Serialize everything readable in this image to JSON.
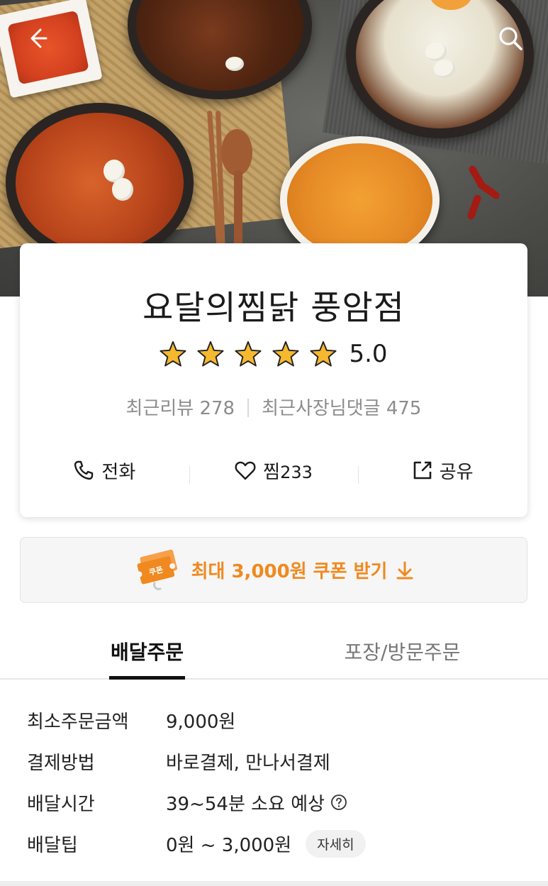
{
  "store": {
    "name": "요달의찜닭 풍암점",
    "rating": "5.0",
    "stars": 5,
    "reviews_label": "최근리뷰 278",
    "owner_replies_label": "최근사장님댓글 475"
  },
  "actions": {
    "call_label": "전화",
    "like_label": "찜",
    "like_count": "233",
    "share_label": "공유"
  },
  "coupon": {
    "ticket_label": "쿠폰",
    "text": "최대 3,000원 쿠폰 받기"
  },
  "tabs": {
    "delivery": "배달주문",
    "pickup": "포장/방문주문",
    "active": "delivery"
  },
  "info": {
    "min_order_label": "최소주문금액",
    "min_order_value": "9,000원",
    "payment_label": "결제방법",
    "payment_value": "바로결제, 만나서결제",
    "delivery_time_label": "배달시간",
    "delivery_time_value": "39~54분 소요 예상",
    "delivery_tip_label": "배달팁",
    "delivery_tip_value": "0원 ~ 3,000원",
    "detail_button": "자세히"
  },
  "colors": {
    "accent": "#f0891f",
    "star": "#f5b82e",
    "text": "#1b1b1b",
    "muted": "#8c8c8c"
  },
  "icons": [
    "back-arrow-icon",
    "search-icon",
    "phone-icon",
    "heart-icon",
    "share-icon",
    "coupon-ticket-icon",
    "download-arrow-icon",
    "help-circle-icon",
    "star-icon"
  ]
}
